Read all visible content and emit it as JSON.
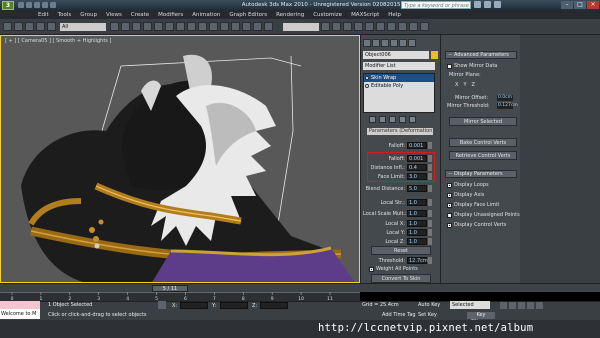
{
  "app": {
    "title": "Autodesk 3ds Max  2010  - Unregistered Version    02082015.max",
    "search_placeholder": "Type a keyword or phrase"
  },
  "menu": [
    "Edit",
    "Tools",
    "Group",
    "Views",
    "Create",
    "Modifiers",
    "Animation",
    "Graph Editors",
    "Rendering",
    "Customize",
    "MAXScript",
    "Help"
  ],
  "toolbar": {
    "selection_filter": "All",
    "named_selection": ""
  },
  "viewport": {
    "label": "[ + ] [ Camera05 ] [ Smooth + Highlights ]"
  },
  "command_panel": {
    "object_name": "Object006",
    "object_color": "#e8c019",
    "modifier_list": "Modifier List",
    "stack": [
      {
        "label": "Skin Wrap",
        "selected": true
      },
      {
        "label": "Editable Poly",
        "selected": false
      }
    ],
    "rollout_partial": "Parameters (Deformation)",
    "params": [
      {
        "label": "Falloff:",
        "value": "0.001"
      },
      {
        "label": "Falloff:",
        "value": "0.001"
      },
      {
        "label": "Distance Infl.:",
        "value": "0.4"
      },
      {
        "label": "Face Limit:",
        "value": "3.0"
      },
      {
        "label": "Blend Distance:",
        "value": "5.0"
      },
      {
        "label": "Local Str.:",
        "value": "1.0"
      },
      {
        "label": "Local Scale Mult.:",
        "value": "1.0"
      },
      {
        "label": "Local X:",
        "value": "1.0"
      },
      {
        "label": "Local Y:",
        "value": "1.0"
      },
      {
        "label": "Local Z:",
        "value": "1.0"
      }
    ],
    "reset_label": "Reset",
    "threshold_label": "Threshold:",
    "threshold_value": "12.7cm",
    "weight_all_label": "Weight All Points",
    "convert_label": "Convert To Skin"
  },
  "right_panel": {
    "advanced_header": "Advanced Parameters",
    "show_mirror": "Show Mirror Data",
    "mirror_plane": "Mirror Plane:",
    "mirror_axes": [
      "X",
      "Y",
      "Z"
    ],
    "mirror_offset_label": "Mirror Offset:",
    "mirror_offset_value": "0.0cm",
    "mirror_threshold_label": "Mirror Threshold:",
    "mirror_threshold_value": "0.127cm",
    "mirror_selected": "Mirror Selected",
    "bake_control": "Bake Control Verts",
    "retrieve_control": "Retrieve Control Verts",
    "display_header": "Display Parameters",
    "display_items": [
      {
        "label": "Display Loops",
        "checked": true
      },
      {
        "label": "Display Axis",
        "checked": true
      },
      {
        "label": "Display Face Limit",
        "checked": true
      },
      {
        "label": "Display Unassigned Points",
        "checked": false
      },
      {
        "label": "Display Control Verts",
        "checked": true
      }
    ]
  },
  "timeline": {
    "frame_display": "5 / 11",
    "ticks": [
      "0",
      "1",
      "2",
      "3",
      "4",
      "5",
      "6",
      "7",
      "8",
      "9",
      "10",
      "11"
    ]
  },
  "status": {
    "maxscript": "Welcome to M",
    "selection": "1 Object Selected",
    "prompt": "Click or click-and-drag to select objects",
    "x_label": "X:",
    "y_label": "Y:",
    "z_label": "Z:",
    "grid": "Grid = 25.4cm",
    "add_time_tag": "Add Time Tag",
    "auto_key": "Auto Key",
    "set_key": "Set Key",
    "selected_option": "Selected",
    "key_filters": "Key Filters..."
  },
  "watermark": "http://lccnetvip.pixnet.net/album"
}
